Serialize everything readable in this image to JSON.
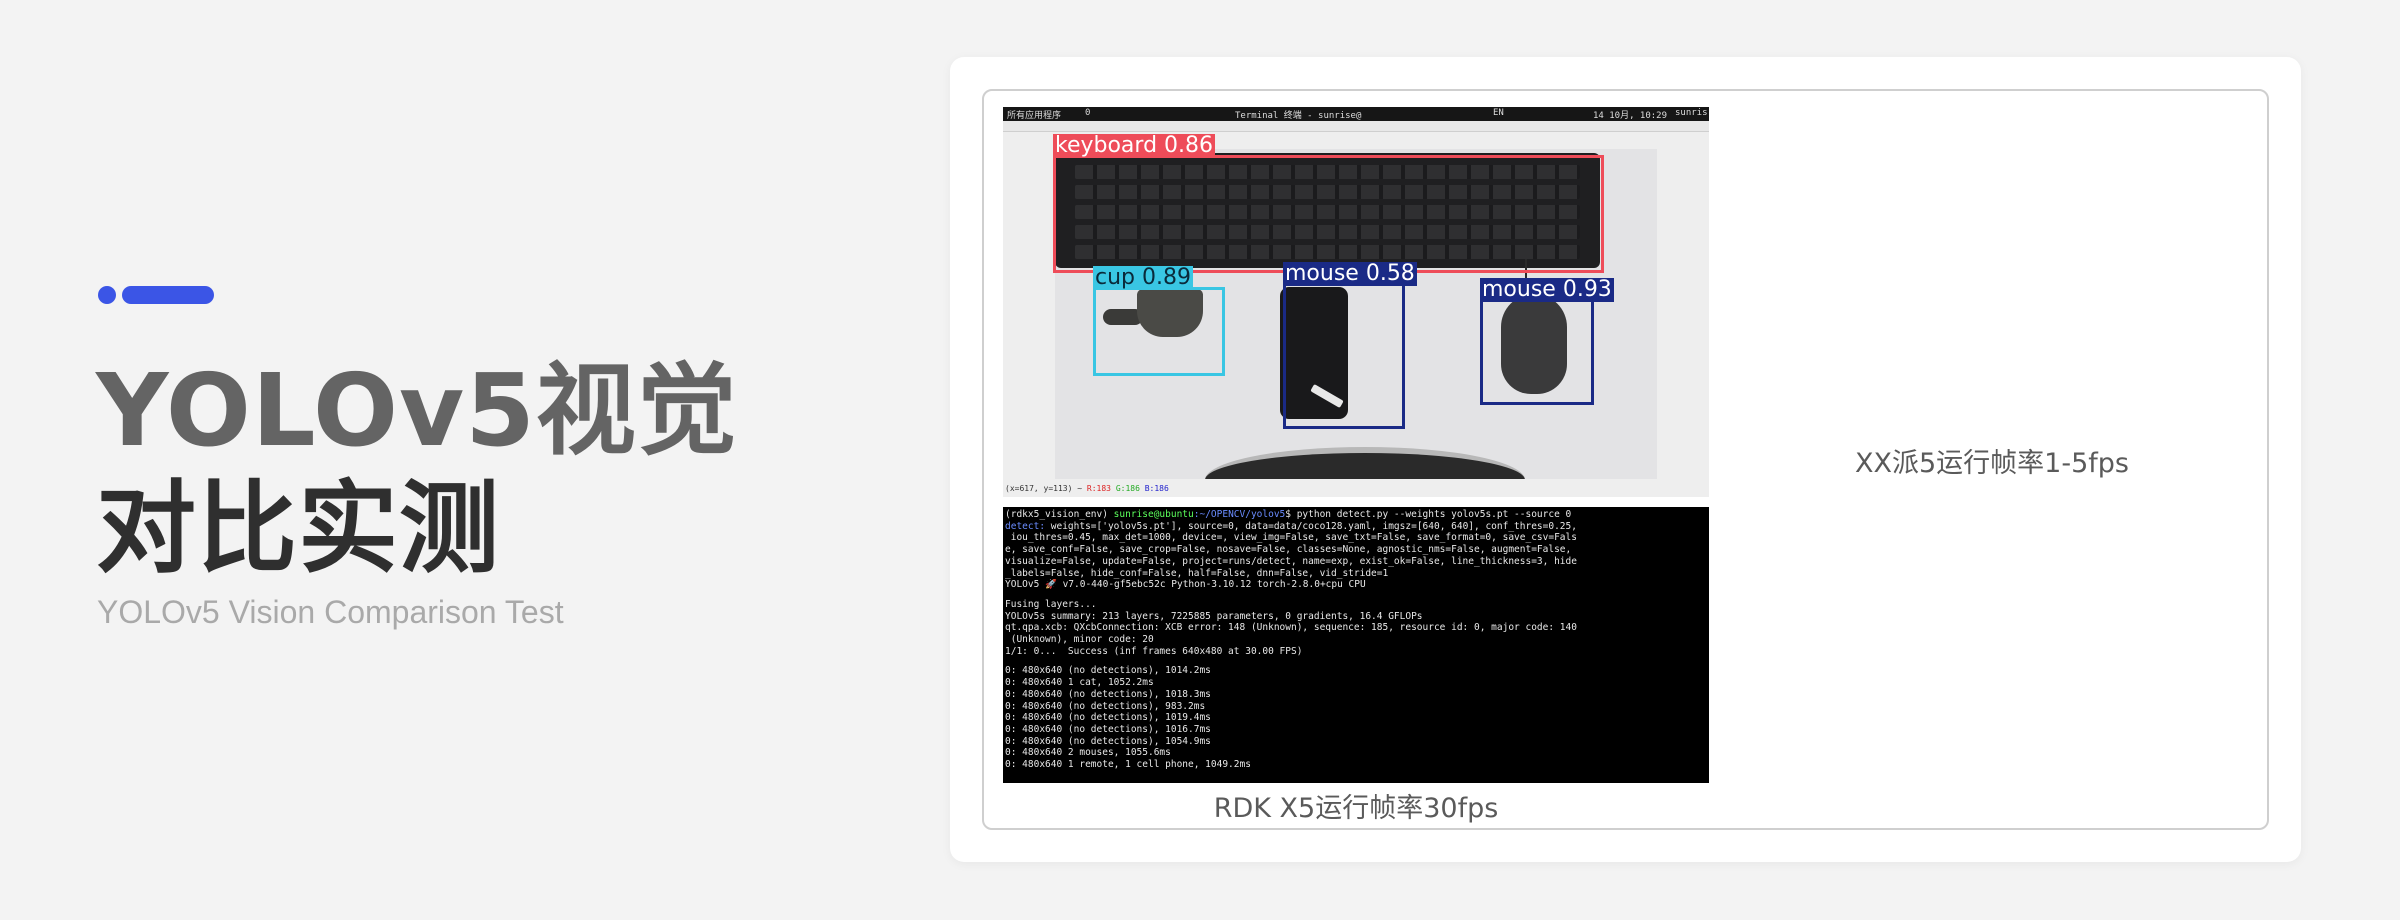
{
  "hero": {
    "title_line1": "YOLOv5视觉",
    "title_line2": "对比实测",
    "subtitle": "YOLOv5 Vision Comparison Test",
    "accent_color": "#3b55e6"
  },
  "screenshot": {
    "topbar": {
      "menu": "所有应用程序",
      "workspace": "0",
      "terminal_tab": "Terminal 终端 - sunrise@",
      "indicators": "EN",
      "datetime": "14 10月, 10:29",
      "user": "sunris"
    },
    "detections": [
      {
        "label": "keyboard 0.86",
        "color": "#ee4c59"
      },
      {
        "label": "cup 0.89",
        "color": "#39c6e3"
      },
      {
        "label": "mouse 0.58",
        "color": "#1a2a86"
      },
      {
        "label": "mouse 0.93",
        "color": "#1a2a86"
      }
    ],
    "status": {
      "coords": "(x=617, y=113) ~",
      "r": "R:183",
      "g": "G:186",
      "b": "B:186"
    }
  },
  "terminal": {
    "prompt_env": "(rdkx5_vision_env) ",
    "prompt_user": "sunrise@ubuntu",
    "prompt_path": ":~/OPENCV/yolov5",
    "command": "$ python detect.py --weights yolov5s.pt --source 0",
    "detect_prefix": "detect: ",
    "args": [
      "weights=['yolov5s.pt'], source=0, data=data/coco128.yaml, imgsz=[640, 640], conf_thres=0.25,",
      " iou_thres=0.45, max_det=1000, device=, view_img=False, save_txt=False, save_format=0, save_csv=Fals",
      "e, save_conf=False, save_crop=False, nosave=False, classes=None, agnostic_nms=False, augment=False,",
      "visualize=False, update=False, project=runs/detect, name=exp, exist_ok=False, line_thickness=3, hide",
      "_labels=False, hide_conf=False, half=False, dnn=False, vid_stride=1"
    ],
    "version": "YOLOv5 🚀 v7.0-440-gf5ebc52c Python-3.10.12 torch-2.8.0+cpu CPU",
    "info": [
      "Fusing layers...",
      "YOLOv5s summary: 213 layers, 7225885 parameters, 0 gradients, 16.4 GFLOPs",
      "qt.qpa.xcb: QXcbConnection: XCB error: 148 (Unknown), sequence: 185, resource id: 0, major code: 140",
      " (Unknown), minor code: 20",
      "1/1: 0...  Success (inf frames 640x480 at 30.00 FPS)"
    ],
    "results": [
      "0: 480x640 (no detections), 1014.2ms",
      "0: 480x640 1 cat, 1052.2ms",
      "0: 480x640 (no detections), 1018.3ms",
      "0: 480x640 (no detections), 983.2ms",
      "0: 480x640 (no detections), 1019.4ms",
      "0: 480x640 (no detections), 1016.7ms",
      "0: 480x640 (no detections), 1054.9ms",
      "0: 480x640 2 mouses, 1055.6ms",
      "0: 480x640 1 remote, 1 cell phone, 1049.2ms"
    ]
  },
  "captions": {
    "left": "RDK X5运行帧率30fps",
    "right": "XX派5运行帧率1-5fps"
  }
}
